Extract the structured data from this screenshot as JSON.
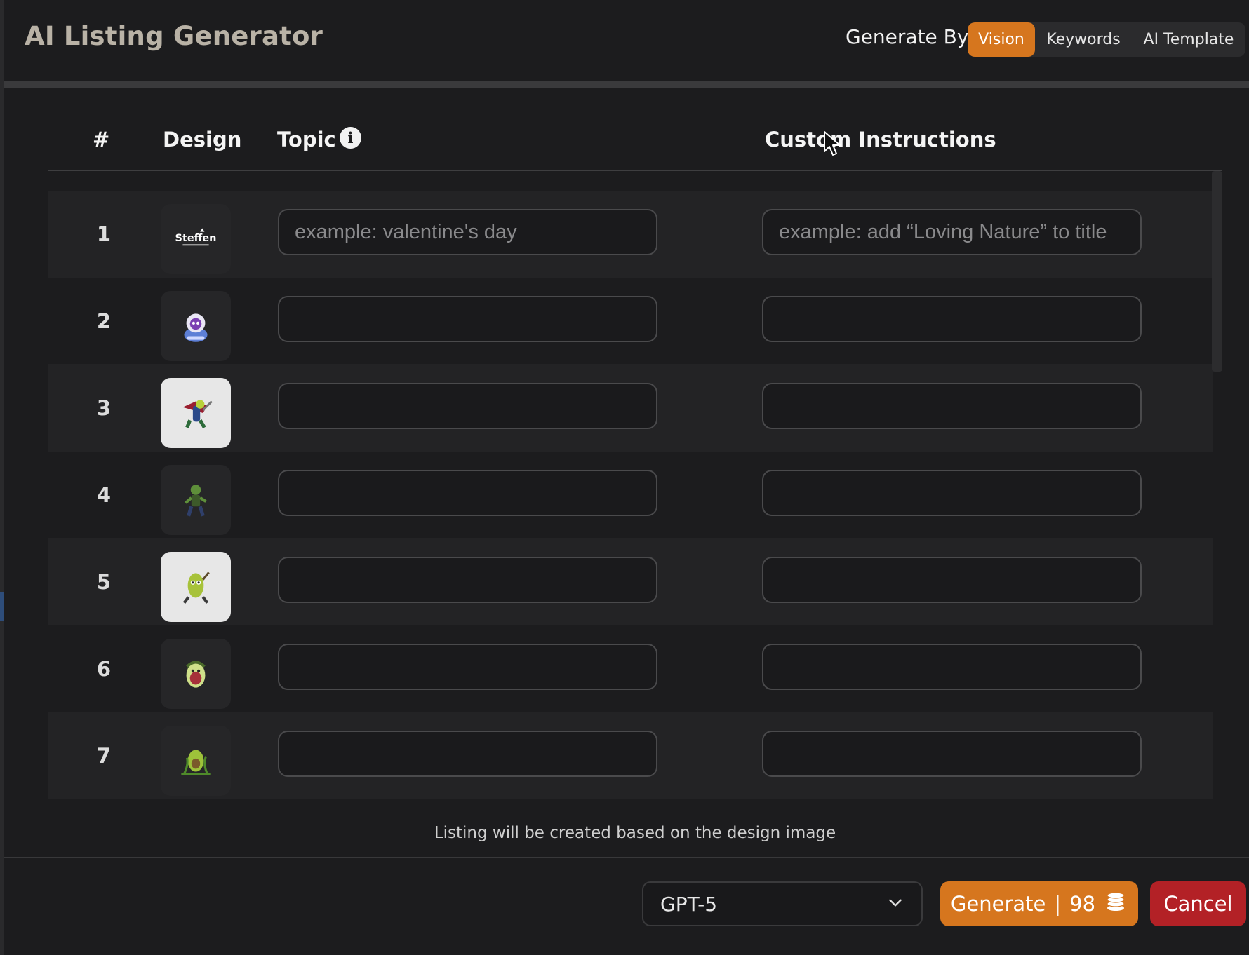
{
  "header": {
    "title": "AI Listing Generator",
    "generate_by_label": "Generate By",
    "modes": [
      "Vision",
      "Keywords",
      "AI Template"
    ],
    "active_mode": "Vision"
  },
  "table": {
    "columns": {
      "number": "#",
      "design": "Design",
      "topic": "Topic",
      "custom": "Custom Instructions"
    },
    "rows": [
      {
        "num": "1",
        "topic_placeholder": "example: valentine's day",
        "custom_placeholder": "example: add “Loving Nature” to title",
        "thumb_bg": "dark",
        "design_text": "Steffen"
      },
      {
        "num": "2",
        "topic_placeholder": "",
        "custom_placeholder": "",
        "thumb_bg": "dark"
      },
      {
        "num": "3",
        "topic_placeholder": "",
        "custom_placeholder": "",
        "thumb_bg": "light"
      },
      {
        "num": "4",
        "topic_placeholder": "",
        "custom_placeholder": "",
        "thumb_bg": "dark"
      },
      {
        "num": "5",
        "topic_placeholder": "",
        "custom_placeholder": "",
        "thumb_bg": "light"
      },
      {
        "num": "6",
        "topic_placeholder": "",
        "custom_placeholder": "",
        "thumb_bg": "dark"
      },
      {
        "num": "7",
        "topic_placeholder": "",
        "custom_placeholder": "",
        "thumb_bg": "dark"
      }
    ]
  },
  "hint": "Listing will be created based on the design image",
  "footer": {
    "model": "GPT-5",
    "generate_label": "Generate",
    "separator": "|",
    "credits": "98",
    "cancel_label": "Cancel"
  },
  "colors": {
    "accent": "#d6761e",
    "danger": "#b32126",
    "background": "#1c1c1e"
  },
  "icons": [
    "info-icon",
    "chevron-down-icon",
    "coins-icon",
    "mouse-pointer-icon"
  ]
}
